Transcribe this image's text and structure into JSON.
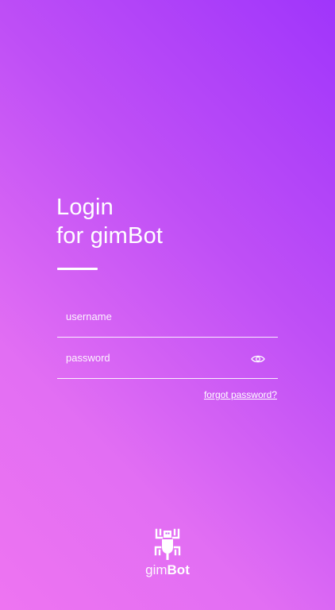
{
  "login": {
    "title_line1": "Login",
    "title_line2": "for gimBot",
    "username_placeholder": "username",
    "password_placeholder": "password",
    "forgot_password": "forgot password?",
    "password_toggle_icon": "eye-icon"
  },
  "brand": {
    "logo_icon": "robot-icon",
    "name_light": "gim",
    "name_bold": "Bot"
  },
  "colors": {
    "gradient_start": "#ee74f2",
    "gradient_end": "#a035fb",
    "text": "#ffffff"
  }
}
